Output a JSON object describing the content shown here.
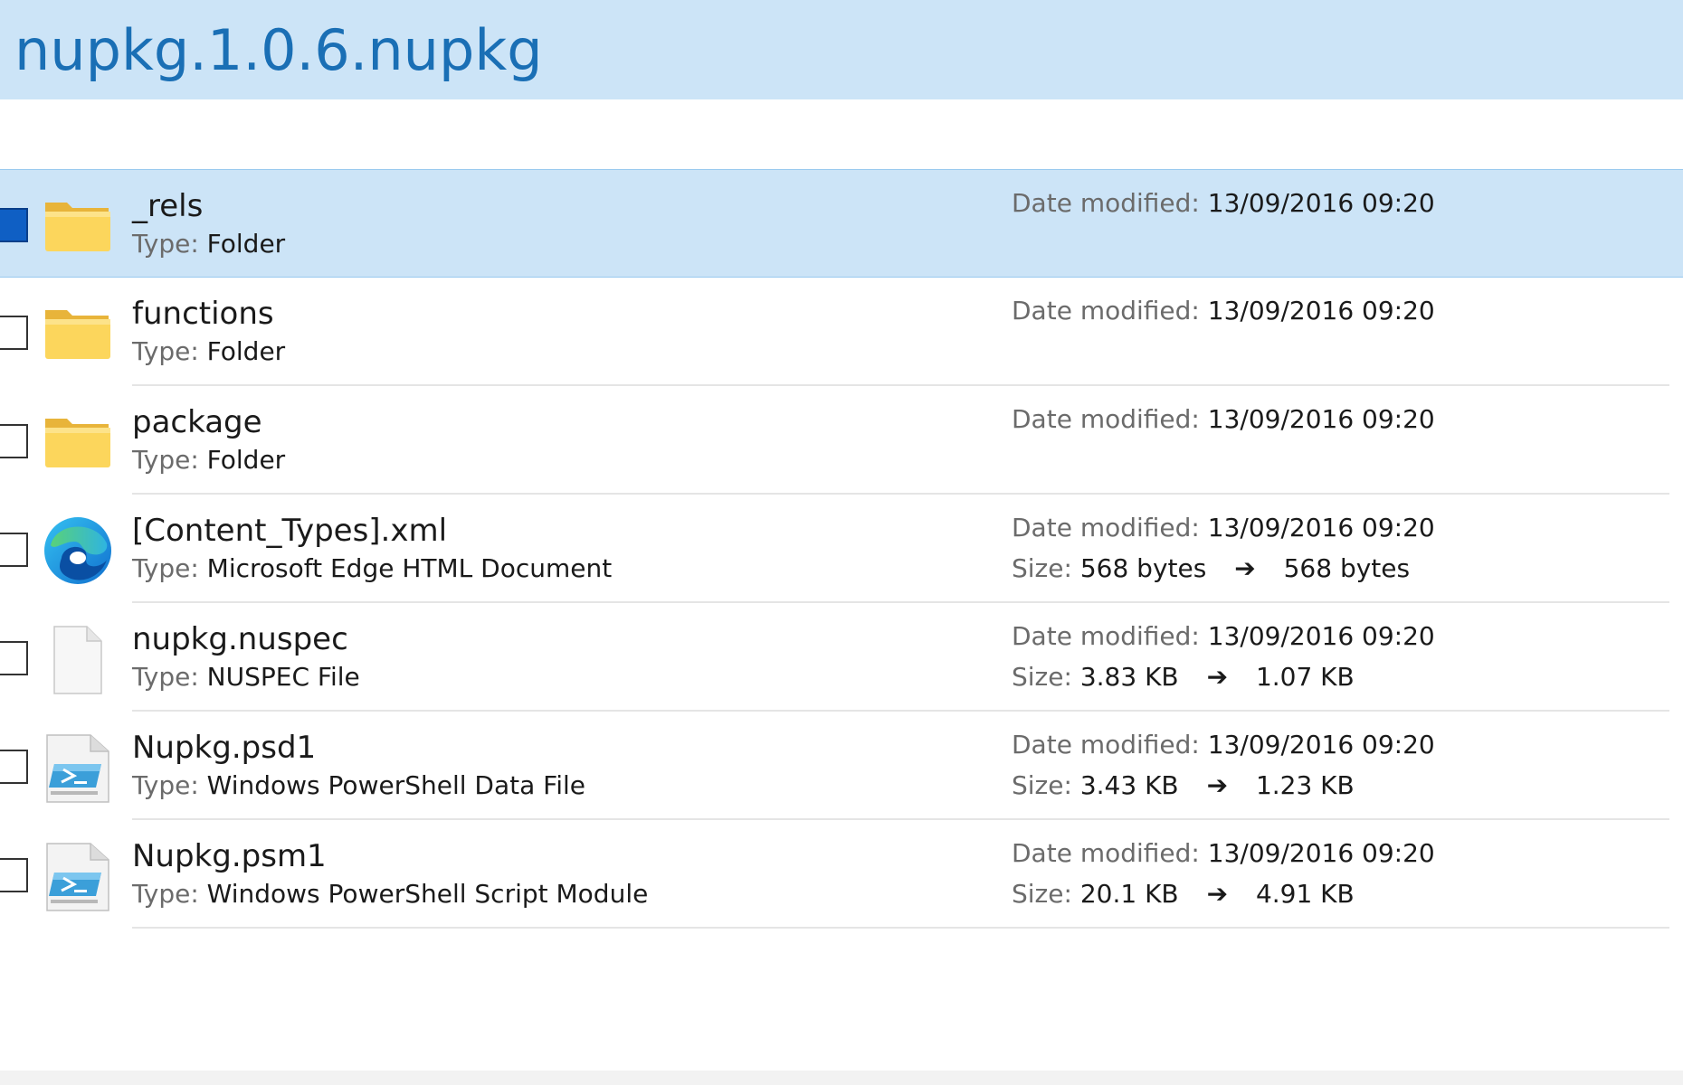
{
  "header": {
    "title": "nupkg.1.0.6.nupkg"
  },
  "labels": {
    "type": "Type:",
    "date_modified": "Date modified:",
    "size": "Size:",
    "arrow": "➔"
  },
  "colors": {
    "header_bg": "#cce4f7",
    "title": "#1a6fb5",
    "selected_bg": "#cce4f7",
    "checkbox_checked": "#0f5fc4",
    "folder": "#fcd65c"
  },
  "items": [
    {
      "name": "_rels",
      "type": "Folder",
      "date": "13/09/2016 09:20",
      "icon": "folder-icon",
      "selected": true
    },
    {
      "name": "functions",
      "type": "Folder",
      "date": "13/09/2016 09:20",
      "icon": "folder-icon",
      "selected": false
    },
    {
      "name": "package",
      "type": "Folder",
      "date": "13/09/2016 09:20",
      "icon": "folder-icon",
      "selected": false
    },
    {
      "name": "[Content_Types].xml",
      "type": "Microsoft Edge HTML Document",
      "date": "13/09/2016 09:20",
      "size_from": "568 bytes",
      "size_to": "568 bytes",
      "icon": "edge-icon",
      "selected": false
    },
    {
      "name": "nupkg.nuspec",
      "type": "NUSPEC File",
      "date": "13/09/2016 09:20",
      "size_from": "3.83 KB",
      "size_to": "1.07 KB",
      "icon": "blank-file-icon",
      "selected": false
    },
    {
      "name": "Nupkg.psd1",
      "type": "Windows PowerShell Data File",
      "date": "13/09/2016 09:20",
      "size_from": "3.43 KB",
      "size_to": "1.23 KB",
      "icon": "powershell-file-icon",
      "selected": false
    },
    {
      "name": "Nupkg.psm1",
      "type": "Windows PowerShell Script Module",
      "date": "13/09/2016 09:20",
      "size_from": "20.1 KB",
      "size_to": "4.91 KB",
      "icon": "powershell-file-icon",
      "selected": false
    }
  ]
}
